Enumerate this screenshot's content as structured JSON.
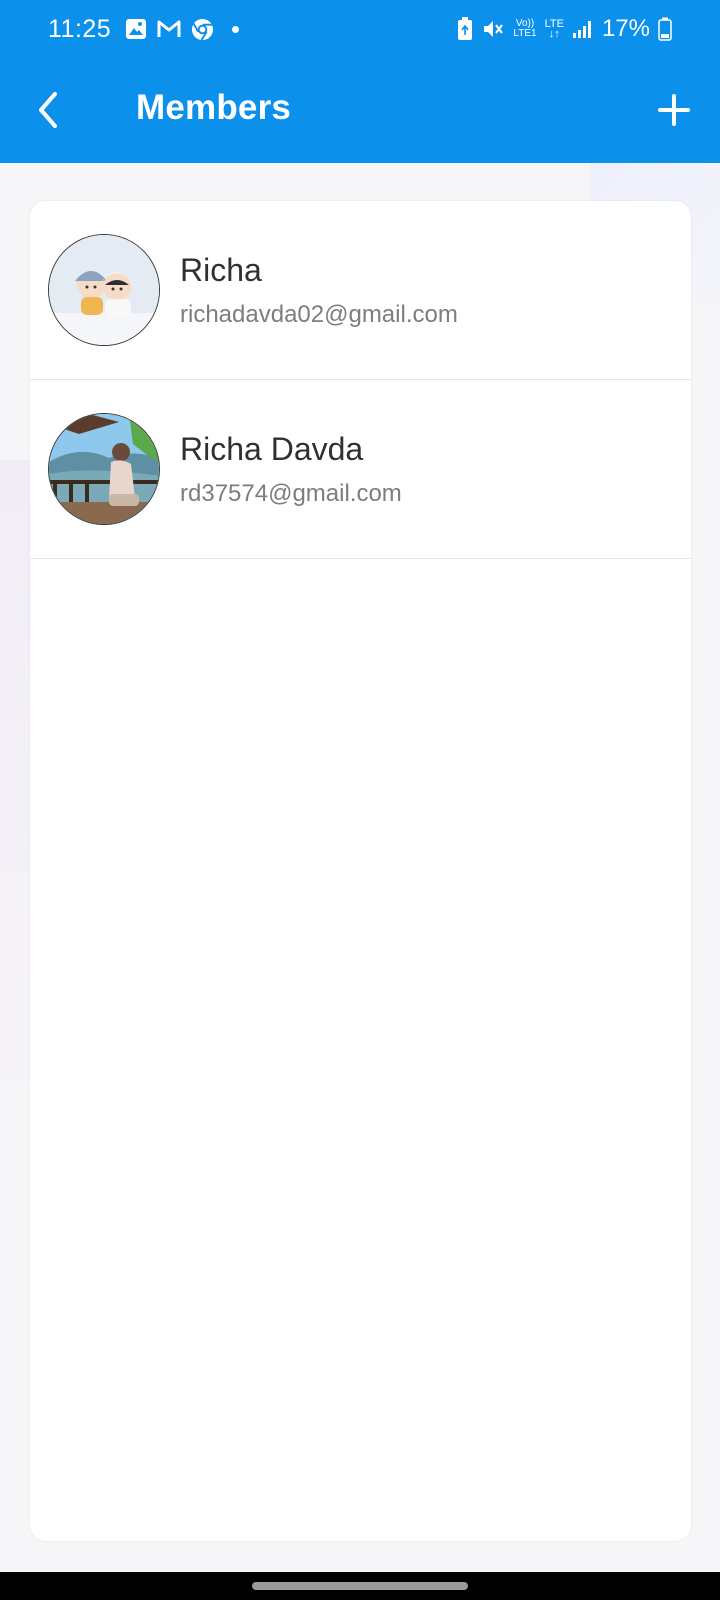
{
  "status_bar": {
    "time": "11:25",
    "battery": "17%",
    "network_volte": "Vo))",
    "network_lte1": "LTE1",
    "network_lte": "LTE",
    "icons": [
      "gallery-icon",
      "gmail-icon",
      "chrome-icon",
      "notification-dot",
      "battery-saver-icon",
      "mute-icon",
      "volte-icon",
      "lte-icon",
      "signal-icon",
      "battery-icon"
    ]
  },
  "app_bar": {
    "title": "Members",
    "back_icon": "chevron-left-icon",
    "add_icon": "plus-icon"
  },
  "colors": {
    "primary": "#0b90ec",
    "name_text": "#303030",
    "email_text": "#7d7d7d"
  },
  "members": [
    {
      "name": "Richa",
      "email": "richadavda02@gmail.com",
      "avatar": "cartoon-avatar"
    },
    {
      "name": "Richa Davda",
      "email": "rd37574@gmail.com",
      "avatar": "photo-avatar"
    }
  ]
}
